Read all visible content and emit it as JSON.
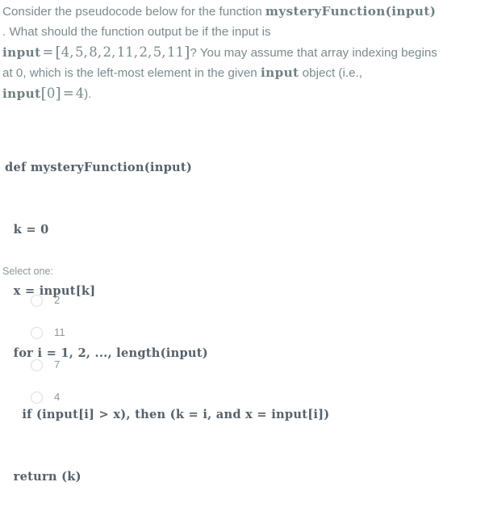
{
  "question": {
    "line1_prefix": "Consider the pseudocode below for the function ",
    "line1_mono": "mysteryFunction(input)",
    "line2": ". What should the function output be if the input is",
    "line3_mono": "input",
    "line3_eq": "=",
    "line3_bracket_open": "[",
    "line3_values": [
      "4",
      "5",
      "8",
      "2",
      "11",
      "2",
      "5",
      "11"
    ],
    "line3_bracket_close": "]",
    "line3_suffix": "? You may assume that array indexing begins",
    "line4_prefix": "at 0, which is the left-most element in the given ",
    "line4_mono": "input",
    "line4_suffix": " object (i.e.,",
    "line5_mono": "input",
    "line5_index_open": "[",
    "line5_index": "0",
    "line5_index_close": "]",
    "line5_eq": "=",
    "line5_value": "4",
    "line5_suffix": ")."
  },
  "pseudocode": {
    "lines": [
      "def mysteryFunction(input)",
      "  k = 0",
      "  x = input[k]",
      "  for i = 1, 2, ..., length(input)",
      "    if (input[i] > x), then (k = i, and x = input[i])",
      "  return (k)"
    ]
  },
  "answers": {
    "instruction": "Select one:",
    "options": [
      {
        "label": "2",
        "selected": false
      },
      {
        "label": "11",
        "selected": false
      },
      {
        "label": "7",
        "selected": false
      },
      {
        "label": "4",
        "selected": false
      }
    ]
  },
  "colors": {
    "background": "#ffffff",
    "body_text": "#7a8a8c",
    "code_text": "#55606a",
    "answer_text": "#8b989a",
    "radio_border": "#dcdcdc"
  }
}
